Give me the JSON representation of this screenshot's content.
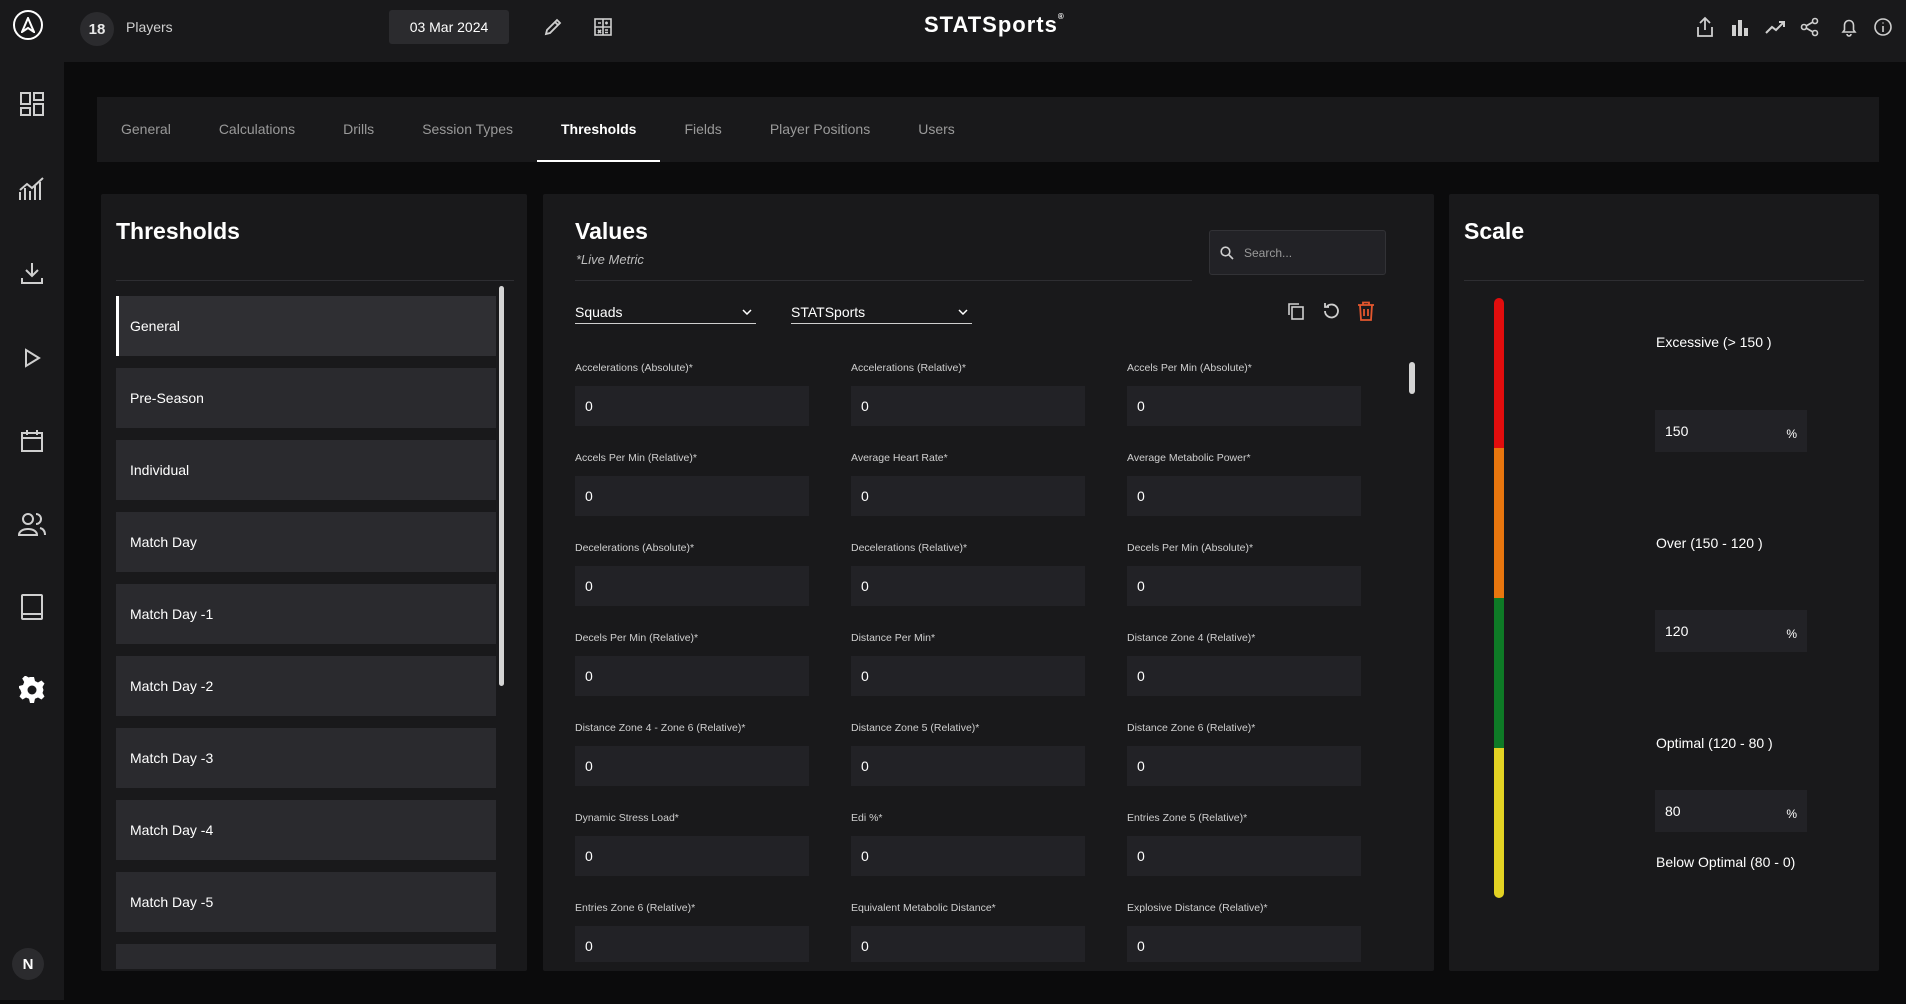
{
  "topbar": {
    "player_count": "18",
    "players_label": "Players",
    "date": "03 Mar 2024",
    "brand": "STATSports"
  },
  "sidebar": {
    "avatar_initial": "N",
    "items": [
      "dashboard-icon",
      "analytics-icon",
      "download-icon",
      "play-icon",
      "calendar-icon",
      "users-icon",
      "tablet-icon",
      "settings-icon"
    ]
  },
  "tabs": [
    "General",
    "Calculations",
    "Drills",
    "Session Types",
    "Thresholds",
    "Fields",
    "Player Positions",
    "Users"
  ],
  "thresholds": {
    "title": "Thresholds",
    "items": [
      "General",
      "Pre-Season",
      "Individual",
      "Match Day",
      "Match Day -1",
      "Match Day -2",
      "Match Day -3",
      "Match Day -4",
      "Match Day -5"
    ]
  },
  "values": {
    "title": "Values",
    "subtitle": "*Live Metric",
    "search_placeholder": "Search...",
    "squad_select": "Squads",
    "org_select": "STATSports",
    "fields": [
      {
        "label": "Accelerations (Absolute)*",
        "value": "0"
      },
      {
        "label": "Accelerations (Relative)*",
        "value": "0"
      },
      {
        "label": "Accels Per Min (Absolute)*",
        "value": "0"
      },
      {
        "label": "Accels Per Min (Relative)*",
        "value": "0"
      },
      {
        "label": "Average Heart Rate*",
        "value": "0"
      },
      {
        "label": "Average Metabolic Power*",
        "value": "0"
      },
      {
        "label": "Decelerations (Absolute)*",
        "value": "0"
      },
      {
        "label": "Decelerations (Relative)*",
        "value": "0"
      },
      {
        "label": "Decels Per Min (Absolute)*",
        "value": "0"
      },
      {
        "label": "Decels Per Min (Relative)*",
        "value": "0"
      },
      {
        "label": "Distance Per Min*",
        "value": "0"
      },
      {
        "label": "Distance Zone 4 (Relative)*",
        "value": "0"
      },
      {
        "label": "Distance Zone 4 - Zone 6 (Relative)*",
        "value": "0"
      },
      {
        "label": "Distance Zone 5 (Relative)*",
        "value": "0"
      },
      {
        "label": "Distance Zone 6 (Relative)*",
        "value": "0"
      },
      {
        "label": "Dynamic Stress Load*",
        "value": "0"
      },
      {
        "label": "Edi %*",
        "value": "0"
      },
      {
        "label": "Entries Zone 5 (Relative)*",
        "value": "0"
      },
      {
        "label": "Entries Zone 6 (Relative)*",
        "value": "0"
      },
      {
        "label": "Equivalent Metabolic Distance*",
        "value": "0"
      },
      {
        "label": "Explosive Distance (Relative)*",
        "value": "0"
      }
    ]
  },
  "scale": {
    "title": "Scale",
    "excessive_label": "Excessive (> 150 )",
    "excessive_value": "150",
    "over_label": "Over (150 - 120 )",
    "over_value": "120",
    "optimal_label": "Optimal (120 - 80 )",
    "optimal_value": "80",
    "below_label": "Below Optimal (80 - 0)",
    "unit": "%",
    "colors": [
      "#e10d0d",
      "#e8760e",
      "#0e7a26",
      "#e3d223"
    ]
  }
}
